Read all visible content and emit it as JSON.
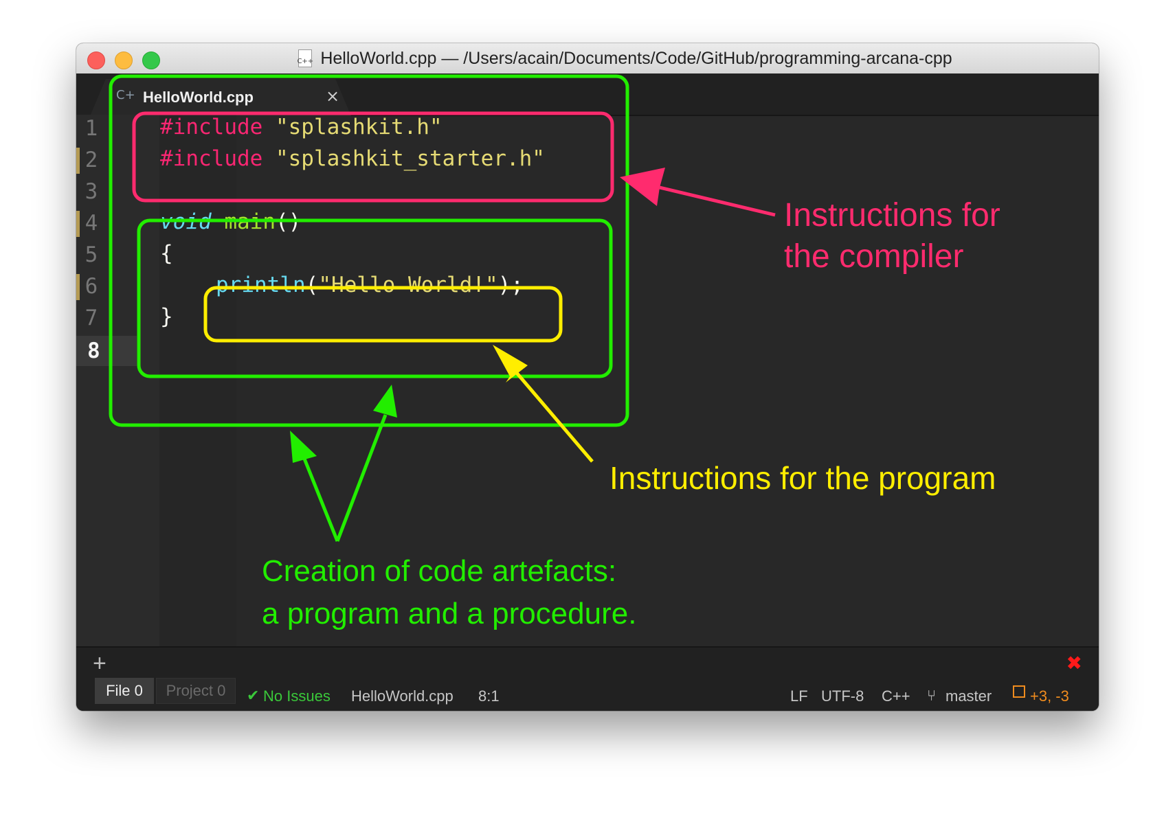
{
  "window": {
    "title": "HelloWorld.cpp — /Users/acain/Documents/Code/GitHub/programming-arcana-cpp",
    "file_icon_text": "C++"
  },
  "tab": {
    "label": "HelloWorld.cpp",
    "icon": "C+",
    "close": "×"
  },
  "gutter": {
    "line_numbers": [
      "1",
      "2",
      "3",
      "4",
      "5",
      "6",
      "7",
      "8"
    ]
  },
  "code": {
    "line1": {
      "directive": "#include",
      "path": "\"splashkit.h\""
    },
    "line2": {
      "directive": "#include",
      "path": "\"splashkit_starter.h\""
    },
    "line4": {
      "keyword": "void",
      "name": "main",
      "parens": "()"
    },
    "line5": "{",
    "line6": {
      "call": "println",
      "open": "(",
      "arg": "\"Hello World!\"",
      "close": ");"
    },
    "line7": "}"
  },
  "status": {
    "add": "+",
    "file_label": "File",
    "file_count": "0",
    "project_label": "Project",
    "project_count": "0",
    "issues": "No Issues",
    "filename": "HelloWorld.cpp",
    "cursor": "8:1",
    "line_ending": "LF",
    "encoding": "UTF-8",
    "grammar": "C++",
    "branch": "master",
    "diff": "+3, -3"
  },
  "annotations": {
    "compiler_line1": "Instructions for",
    "compiler_line2": "the compiler",
    "program": "Instructions for the program",
    "artefacts_line1": "Creation of code artefacts:",
    "artefacts_line2": "a program and a procedure."
  },
  "colors": {
    "compiler": "#ff2b6e",
    "program": "#ffee00",
    "artefacts": "#22ee00"
  }
}
